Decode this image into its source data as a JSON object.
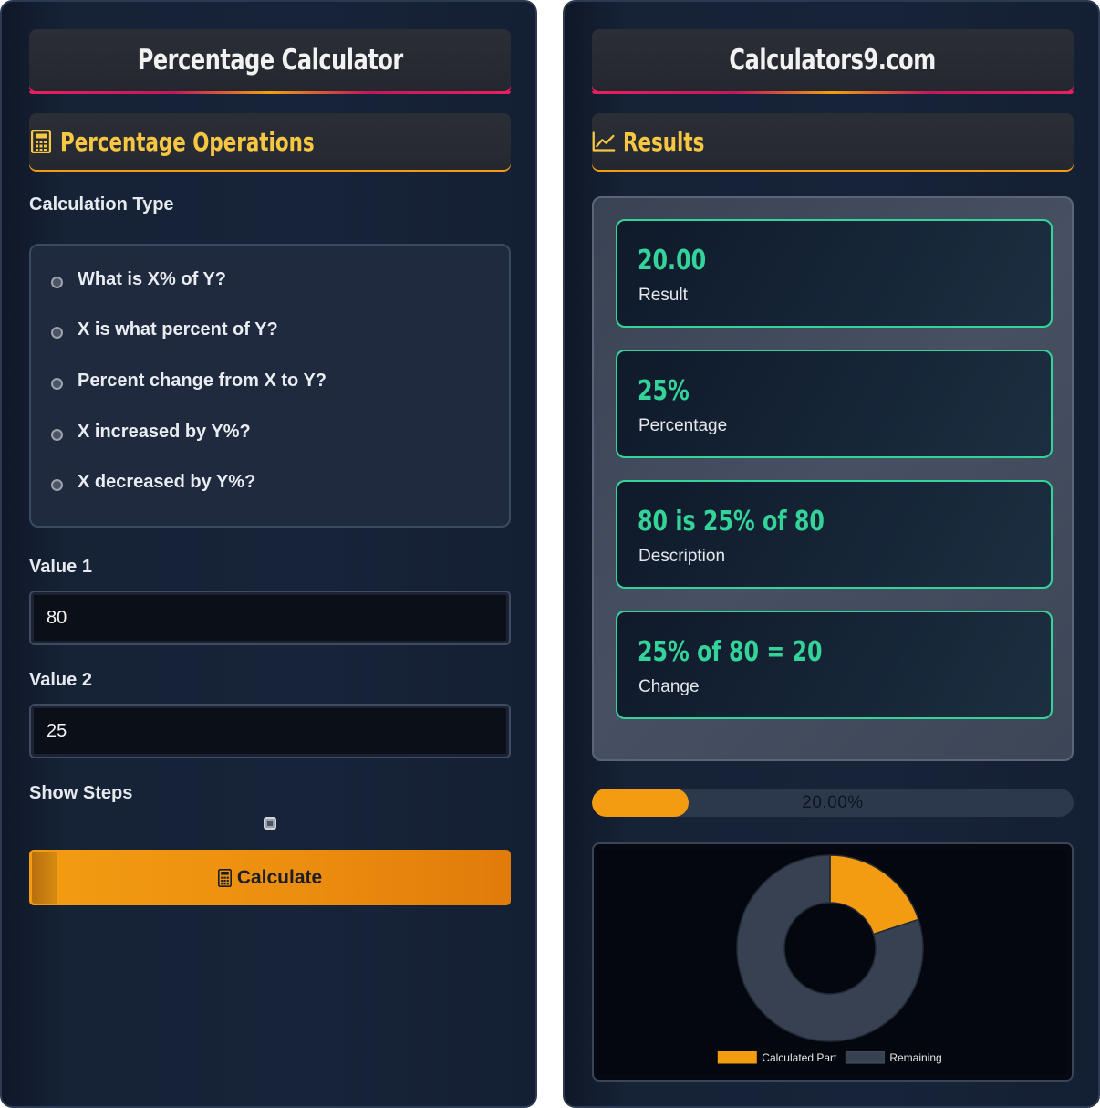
{
  "left": {
    "header_title": "Percentage Calculator",
    "section_title": "Percentage Operations",
    "section_icon": "calculator-icon",
    "calc_type_label": "Calculation Type",
    "options": [
      "What is X% of Y?",
      "X is what percent of Y?",
      "Percent change from X to Y?",
      "X increased by Y%?",
      "X decreased by Y%?"
    ],
    "value1_label": "Value 1",
    "value1": "80",
    "value2_label": "Value 2",
    "value2": "25",
    "show_steps_label": "Show Steps",
    "calculate_label": "Calculate",
    "calculate_icon": "calculator-icon"
  },
  "right": {
    "header_title": "Calculators9.com",
    "section_title": "Results",
    "section_icon": "line-chart-icon",
    "results": [
      {
        "value": "20.00",
        "label": "Result"
      },
      {
        "value": "25%",
        "label": "Percentage"
      },
      {
        "value": "80 is 25% of 80",
        "label": "Description"
      },
      {
        "value": "25% of 80 = 20",
        "label": "Change"
      }
    ],
    "progress_fraction": 0.2,
    "progress_text": "20.00%"
  },
  "colors": {
    "accent": "#f39c12",
    "result_green": "#34d399",
    "heading_yellow": "#f7c744",
    "header_pink": "#e91e63"
  },
  "chart_data": {
    "type": "pie",
    "subtype": "doughnut",
    "categories": [
      "Calculated Part",
      "Remaining"
    ],
    "values": [
      20,
      80
    ],
    "colors": [
      "#f39c12",
      "#374151"
    ],
    "legend_position": "bottom"
  }
}
